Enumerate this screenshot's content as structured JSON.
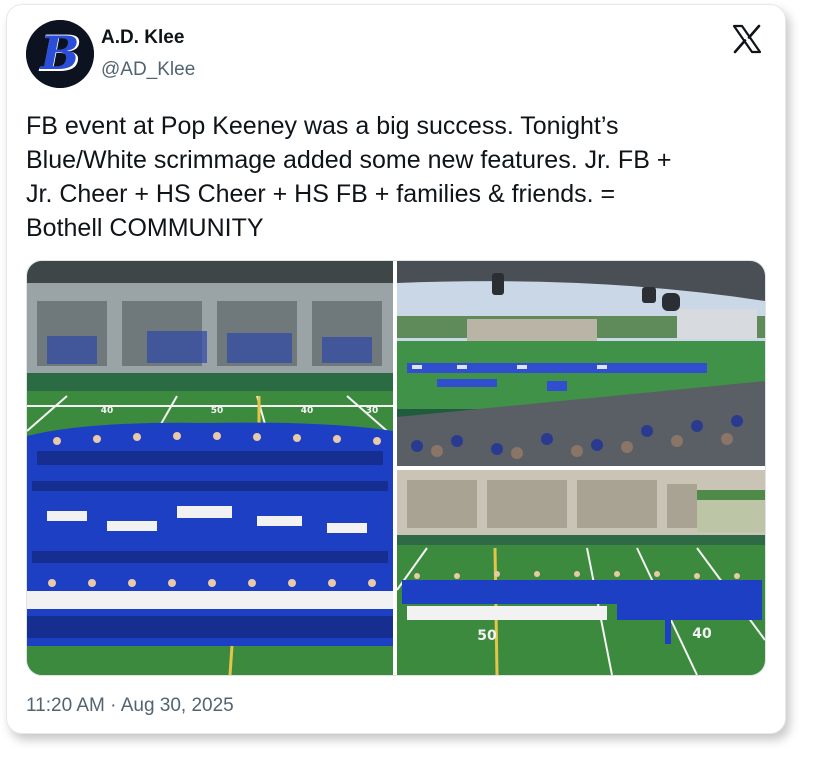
{
  "author": {
    "name": "A.D. Klee",
    "handle": "@AD_Klee",
    "avatar_icon": "letter-b-logo",
    "avatar_letter": "B"
  },
  "platform_icon": "x-logo-icon",
  "tweet": {
    "text": "FB event at Pop Keeney was a big success. Tonight’s\nBlue/White scrimmage added some new features. Jr. FB +\nJr. Cheer + HS Cheer + HS FB + families & friends. =\nBothell COMMUNITY"
  },
  "media": {
    "photos": [
      {
        "field_numbers": [
          "40",
          "50",
          "40",
          "30"
        ]
      },
      {
        "field_numbers": []
      },
      {
        "field_numbers": [
          "50",
          "40"
        ]
      }
    ]
  },
  "footer": {
    "timestamp": "11:20 AM · Aug 30, 2025"
  },
  "colors": {
    "text_primary": "#0f1419",
    "text_secondary": "#536471",
    "team_blue": "#1d3fc4",
    "field_green": "#3c8a3e"
  }
}
